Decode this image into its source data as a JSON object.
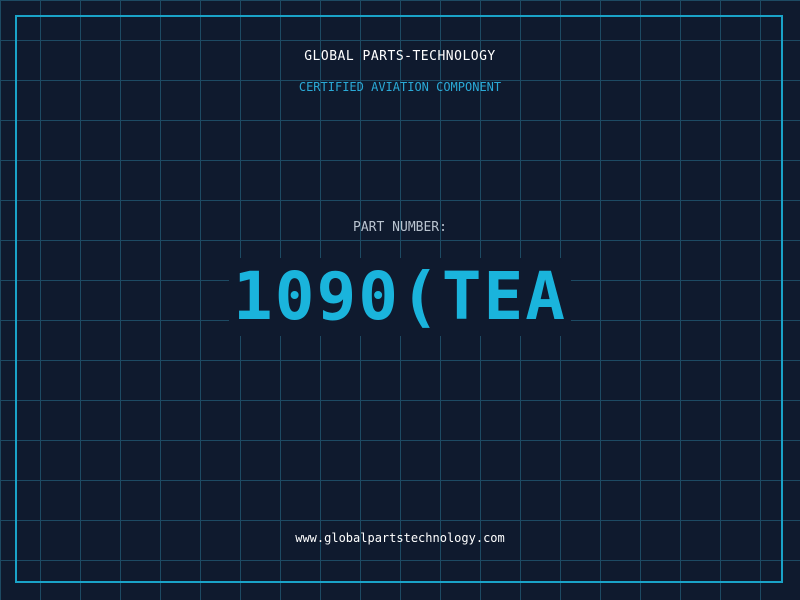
{
  "header": {
    "company": "GLOBAL PARTS-TECHNOLOGY",
    "certification": "CERTIFIED AVIATION COMPONENT"
  },
  "part": {
    "label": "PART NUMBER:",
    "number": "1090(TEA"
  },
  "footer": {
    "url": "www.globalpartstechnology.com"
  },
  "colors": {
    "background": "#0f1a2e",
    "grid": "#1d4a63",
    "accent": "#1ab4dc",
    "text": "#ffffff"
  }
}
